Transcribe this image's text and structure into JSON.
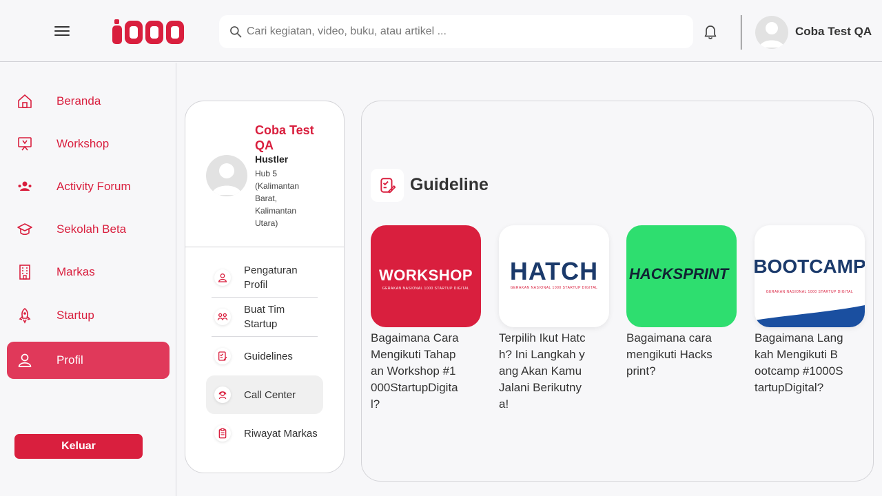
{
  "header": {
    "search_placeholder": "Cari kegiatan, video, buku, atau artikel ...",
    "username": "Coba Test QA"
  },
  "sidebar": {
    "items": [
      {
        "label": "Beranda",
        "icon": "home-icon"
      },
      {
        "label": "Workshop",
        "icon": "presentation-icon"
      },
      {
        "label": "Activity Forum",
        "icon": "group-icon"
      },
      {
        "label": "Sekolah Beta",
        "icon": "graduation-cap-icon"
      },
      {
        "label": "Markas",
        "icon": "building-icon"
      },
      {
        "label": "Startup",
        "icon": "rocket-icon"
      },
      {
        "label": "Profil",
        "icon": "user-icon",
        "active": true
      }
    ],
    "logout_label": "Keluar"
  },
  "profile": {
    "name": "Coba Test QA",
    "role": "Hustler",
    "hub": "Hub 5 (Kalimantan Barat, Kalimantan Utara)",
    "menu": [
      {
        "label": "Pengaturan Profil",
        "icon": "user-icon"
      },
      {
        "label": "Buat Tim Startup",
        "icon": "team-icon"
      },
      {
        "label": "Guidelines",
        "icon": "checklist-icon"
      },
      {
        "label": "Call Center",
        "icon": "headset-icon",
        "selected": true
      },
      {
        "label": "Riwayat Markas",
        "icon": "clipboard-icon"
      }
    ]
  },
  "guideline": {
    "title": "Guideline",
    "cards": [
      {
        "brand": "WORKSHOP",
        "caption": "Bagaimana Cara Mengikuti Tahapan Workshop #1000StartupDigital?"
      },
      {
        "brand": "HATCH",
        "caption": "Terpilih Ikut Hatch? Ini Langkah yang Akan Kamu Jalani Berikutnya!"
      },
      {
        "brand": "HACKSPRINT",
        "caption": "Bagaimana cara mengikuti Hacksprint?"
      },
      {
        "brand": "BOOTCAMP",
        "caption": "Bagaimana Langkah Mengikuti Bootcamp #1000StartupDigital?"
      }
    ],
    "brand_sub": "GERAKAN NASIONAL 1000 STARTUP DIGITAL"
  },
  "colors": {
    "accent": "#d91f3e",
    "active_nav": "#e0395a",
    "hacksprint_green": "#2ede6f",
    "bootcamp_blue": "#1a4fa0"
  }
}
